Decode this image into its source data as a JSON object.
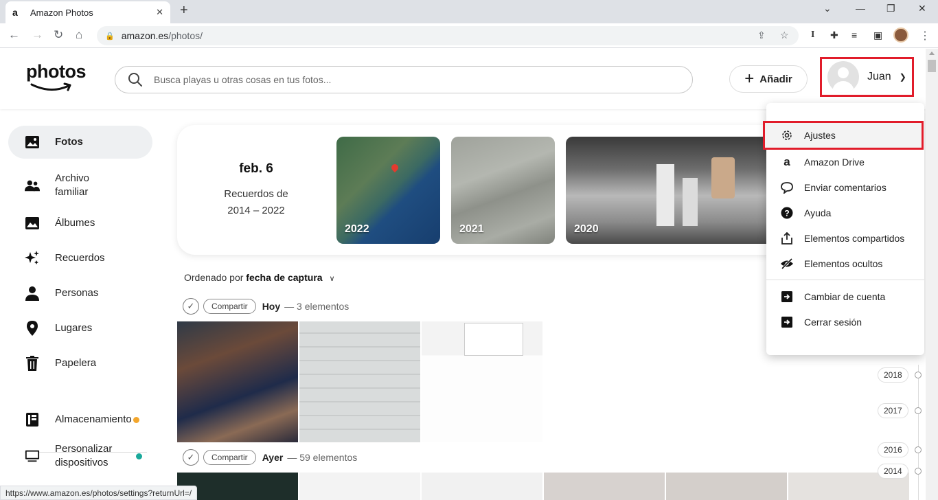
{
  "browser": {
    "tab_title": "Amazon Photos",
    "tab_favicon": "a",
    "url_host": "amazon.es",
    "url_path": "/photos/",
    "status_url": "https://www.amazon.es/photos/settings?returnUrl=/"
  },
  "header": {
    "logo_text": "photos",
    "search_placeholder": "Busca playas u otras cosas en tus fotos...",
    "add_label": "Añadir",
    "user_name": "Juan"
  },
  "sidebar": {
    "items": [
      {
        "label": "Fotos",
        "icon": "photo-icon"
      },
      {
        "label": "Archivo familiar",
        "icon": "family-icon"
      },
      {
        "label": "Álbumes",
        "icon": "album-icon"
      },
      {
        "label": "Recuerdos",
        "icon": "sparkle-icon"
      },
      {
        "label": "Personas",
        "icon": "person-icon"
      },
      {
        "label": "Lugares",
        "icon": "place-icon"
      },
      {
        "label": "Papelera",
        "icon": "trash-icon"
      },
      {
        "label": "Almacenamiento",
        "icon": "storage-icon"
      },
      {
        "label": "Personalizar dispositivos",
        "icon": "device-icon"
      }
    ]
  },
  "memories": {
    "date": "feb. 6",
    "subtitle": "Recuerdos de 2014 – 2022",
    "cards": [
      "2022",
      "2021",
      "2020"
    ]
  },
  "sort": {
    "prefix": "Ordenado por",
    "value": "fecha de captura"
  },
  "groups": [
    {
      "share_label": "Compartir",
      "title": "Hoy",
      "count": "— 3 elementos"
    },
    {
      "share_label": "Compartir",
      "title": "Ayer",
      "count": "— 59 elementos"
    }
  ],
  "dropdown": {
    "items": [
      {
        "label": "Ajustes",
        "icon": "gear-icon"
      },
      {
        "label": "Amazon Drive",
        "icon": "amazon-icon"
      },
      {
        "label": "Enviar comentarios",
        "icon": "feedback-icon"
      },
      {
        "label": "Ayuda",
        "icon": "help-icon"
      },
      {
        "label": "Elementos compartidos",
        "icon": "share-icon"
      },
      {
        "label": "Elementos ocultos",
        "icon": "hidden-icon"
      },
      {
        "label": "Cambiar de cuenta",
        "icon": "switch-account-icon"
      },
      {
        "label": "Cerrar sesión",
        "icon": "sign-out-icon"
      }
    ]
  },
  "timeline": [
    "2018",
    "2017",
    "2016",
    "2014"
  ],
  "colors": {
    "highlight_border": "#e11c2a",
    "storage_dot": "#f3a62c",
    "device_dot": "#1aa99b"
  }
}
